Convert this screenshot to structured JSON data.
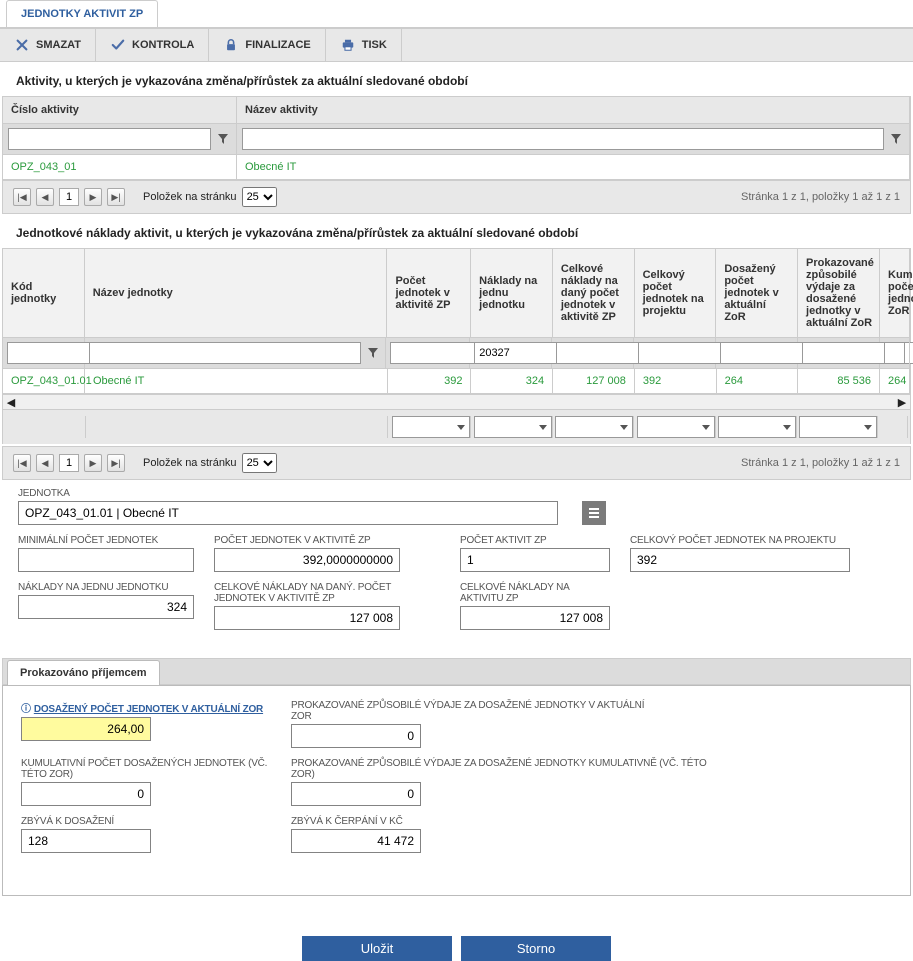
{
  "tab_title": "JEDNOTKY AKTIVIT ZP",
  "toolbar": {
    "smazat": "SMAZAT",
    "kontrola": "KONTROLA",
    "finalizace": "FINALIZACE",
    "tisk": "TISK"
  },
  "section1": {
    "title": "Aktivity, u kterých je vykazována změna/přírůstek za aktuální sledované období",
    "cols": [
      "Číslo aktivity",
      "Název aktivity"
    ],
    "row": [
      "OPZ_043_01",
      "Obecné IT"
    ]
  },
  "pager": {
    "label": "Položek na stránku",
    "size": "25",
    "page": "1",
    "info": "Stránka 1 z 1, položky 1 až 1 z 1"
  },
  "section2": {
    "title": "Jednotkové náklady aktivit, u kterých je vykazována změna/přírůstek za aktuální sledované období",
    "cols": [
      "Kód jednotky",
      "Název jednotky",
      "Počet jednotek v aktivitě ZP",
      "Náklady na jednu jednotku",
      "Celkové náklady na daný počet jednotek v aktivitě ZP",
      "Celkový počet jednotek na projektu",
      "Dosažený počet jednotek v aktuální ZoR",
      "Prokazované způsobilé výdaje za dosažené jednotky v aktuální ZoR",
      "Kum poče jedno ZoR"
    ],
    "filter_c4": "20327",
    "row": [
      "OPZ_043_01.01",
      "Obecné IT",
      "392",
      "324",
      "127 008",
      "392",
      "264",
      "85 536",
      "264"
    ]
  },
  "form": {
    "jednotka_label": "JEDNOTKA",
    "jednotka": "OPZ_043_01.01 | Obecné IT",
    "min_label": "MINIMÁLNÍ POČET JEDNOTEK",
    "min": "",
    "pocet_akt_label": "POČET JEDNOTEK V AKTIVITĚ ZP",
    "pocet_akt": "392,0000000000",
    "pocet_zp_label": "POČET AKTIVIT ZP",
    "pocet_zp": "1",
    "celk_proj_label": "CELKOVÝ POČET JEDNOTEK NA PROJEKTU",
    "celk_proj": "392",
    "naklady_j_label": "NÁKLADY NA JEDNU JEDNOTKU",
    "naklady_j": "324",
    "celk_dany_label": "CELKOVÉ NÁKLADY NA DANÝ. POČET JEDNOTEK V AKTIVITĚ ZP",
    "celk_dany": "127 008",
    "celk_akt_label": "CELKOVÉ NÁKLADY NA AKTIVITU ZP",
    "celk_akt": "127 008"
  },
  "subtab": "Prokazováno příjemcem",
  "subform": {
    "dosazeny_label": "DOSAŽENÝ POČET JEDNOTEK V AKTUÁLNÍ ZOR",
    "dosazeny": "264,00",
    "kumul_label": "KUMULATIVNÍ POČET DOSAŽENÝCH JEDNOTEK (VČ. TÉTO ZOR)",
    "kumul": "0",
    "zbyva_label": "ZBÝVÁ K DOSAŽENÍ",
    "zbyva": "128",
    "prok_akt_label": "PROKAZOVANÉ ZPŮSOBILÉ VÝDAJE ZA DOSAŽENÉ JEDNOTKY V AKTUÁLNÍ ZOR",
    "prok_akt": "0",
    "prok_kum_label": "PROKAZOVANÉ ZPŮSOBILÉ VÝDAJE ZA DOSAŽENÉ JEDNOTKY KUMULATIVNĚ (VČ. TÉTO ZOR)",
    "prok_kum": "0",
    "zbyva_kc_label": "ZBÝVÁ K ČERPÁNÍ V KČ",
    "zbyva_kc": "41 472"
  },
  "actions": {
    "ulozit": "Uložit",
    "storno": "Storno"
  }
}
